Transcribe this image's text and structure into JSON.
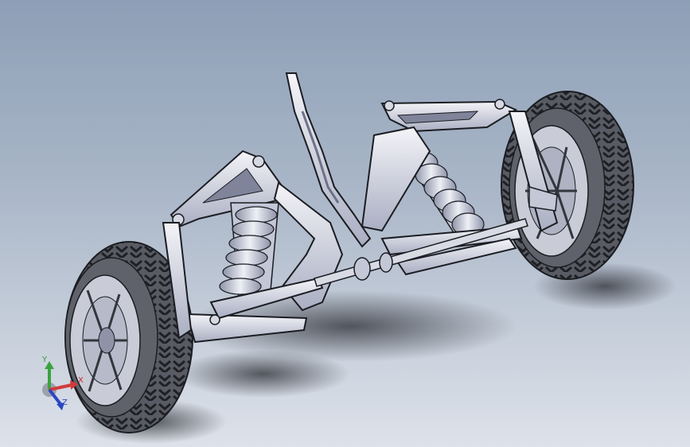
{
  "viewport": {
    "background_top": "#8d9fb6",
    "background_bottom": "#dde2ea"
  },
  "model": {
    "description_icon": "front-suspension-assembly",
    "colors": {
      "tire": "#4a4d55",
      "rim": "#c8cbd6",
      "metal": "#e6e6ee",
      "metal_shade": "#9aa0b5",
      "spring": "#b9bed2",
      "outline": "#1b1d22"
    }
  },
  "triad": {
    "x_label": "X",
    "y_label": "Y",
    "z_label": "Z",
    "x_color": "#d23a3a",
    "y_color": "#39a33f",
    "z_color": "#2b46c4"
  }
}
